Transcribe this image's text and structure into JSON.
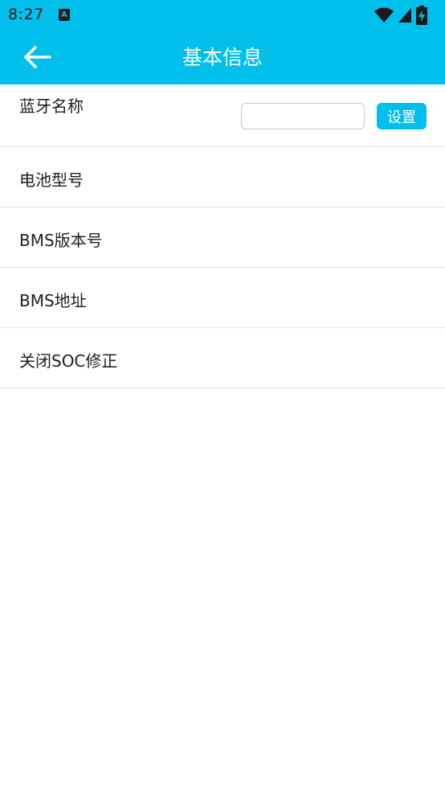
{
  "status_bar": {
    "time": "8:27",
    "notification_icon": "a-letter-icon",
    "icons": [
      "wifi-icon",
      "signal-icon",
      "battery-charging-icon"
    ]
  },
  "app_bar": {
    "title": "基本信息",
    "back_icon": "arrow-left-icon"
  },
  "rows": [
    {
      "label": "蓝牙名称",
      "input_value": "",
      "button_label": "设置"
    },
    {
      "label": "电池型号"
    },
    {
      "label": "BMS版本号"
    },
    {
      "label": "BMS地址"
    },
    {
      "label": "关闭SOC修正"
    }
  ],
  "colors": {
    "accent": "#00bfea",
    "text": "#1f1f1f",
    "divider": "#e6e6e6"
  }
}
